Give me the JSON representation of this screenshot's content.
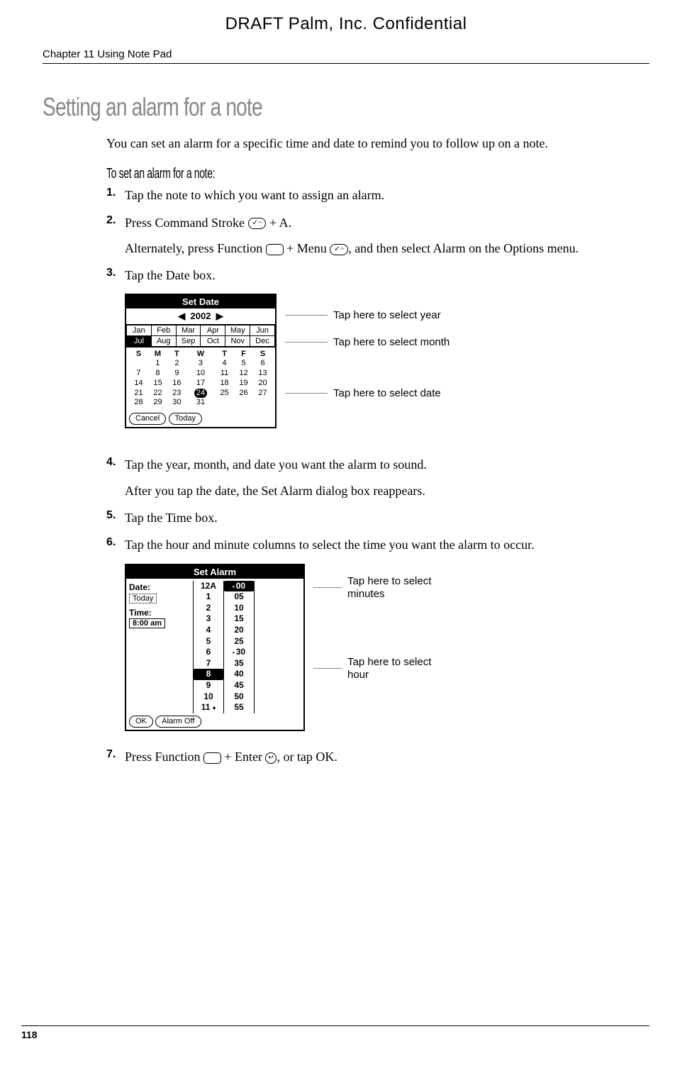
{
  "header": {
    "draft": "DRAFT   Palm, Inc. Confidential",
    "chapter": "Chapter 11    Using Note Pad"
  },
  "section": {
    "title": "Setting an alarm for a note",
    "intro": "You can set an alarm for a specific time and date to remind you to follow up on a note.",
    "subhead": "To set an alarm for a note:"
  },
  "steps": {
    "s1_num": "1.",
    "s1_text": "Tap the note to which you want to assign an alarm.",
    "s2_num": "2.",
    "s2_pre": "Press Command Stroke ",
    "s2_post": " + A.",
    "s2_alt_pre": "Alternately, press Function ",
    "s2_alt_mid": " + Menu ",
    "s2_alt_post": ", and then select Alarm on the Options menu.",
    "s3_num": "3.",
    "s3_text": "Tap the Date box.",
    "s4_num": "4.",
    "s4_text": "Tap the year, month, and date you want the alarm to sound.",
    "s4_sub": "After you tap the date, the Set Alarm dialog box reappears.",
    "s5_num": "5.",
    "s5_text": "Tap the Time box.",
    "s6_num": "6.",
    "s6_text": "Tap the hour and minute columns to select the time you want the alarm to occur.",
    "s7_num": "7.",
    "s7_pre": "Press Function ",
    "s7_mid": " + Enter ",
    "s7_post": ", or tap OK."
  },
  "date_dialog": {
    "title": "Set Date",
    "year": "2002",
    "months_r1": [
      "Jan",
      "Feb",
      "Mar",
      "Apr",
      "May",
      "Jun"
    ],
    "months_r2": [
      "Jul",
      "Aug",
      "Sep",
      "Oct",
      "Nov",
      "Dec"
    ],
    "selected_month": "Jul",
    "dow": [
      "S",
      "M",
      "T",
      "W",
      "T",
      "F",
      "S"
    ],
    "weeks": [
      [
        "",
        "1",
        "2",
        "3",
        "4",
        "5",
        "6"
      ],
      [
        "7",
        "8",
        "9",
        "10",
        "11",
        "12",
        "13"
      ],
      [
        "14",
        "15",
        "16",
        "17",
        "18",
        "19",
        "20"
      ],
      [
        "21",
        "22",
        "23",
        "24",
        "25",
        "26",
        "27"
      ],
      [
        "28",
        "29",
        "30",
        "31",
        "",
        "",
        ""
      ]
    ],
    "selected_date": "24",
    "btn_cancel": "Cancel",
    "btn_today": "Today",
    "callout_year": "Tap here to select year",
    "callout_month": "Tap here to select month",
    "callout_date": "Tap here to select date"
  },
  "alarm_dialog": {
    "title": "Set Alarm",
    "date_label": "Date:",
    "date_value": "Today",
    "time_label": "Time:",
    "time_value": "8:00 am",
    "hours": [
      "12A",
      "1",
      "2",
      "3",
      "4",
      "5",
      "6",
      "7",
      "8",
      "9",
      "10",
      "11"
    ],
    "selected_hour": "8",
    "minutes": [
      "00",
      "05",
      "10",
      "15",
      "20",
      "25",
      "30",
      "35",
      "40",
      "45",
      "50",
      "55"
    ],
    "marked_minutes": [
      "00",
      "30"
    ],
    "btn_ok": "OK",
    "btn_off": "Alarm Off",
    "callout_min": "Tap here to select minutes",
    "callout_hour": "Tap here to select hour"
  },
  "icons": {
    "stroke": "✓𝄐",
    "enter": "↵"
  },
  "footer": {
    "page": "118"
  }
}
